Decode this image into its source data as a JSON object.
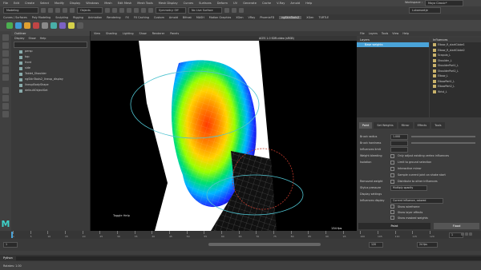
{
  "menubar": {
    "items": [
      "File",
      "Edit",
      "Create",
      "Select",
      "Modify",
      "Display",
      "Windows",
      "Mesh",
      "Edit Mesh",
      "Mesh Tools",
      "Mesh Display",
      "Curves",
      "Surfaces",
      "Deform",
      "UV",
      "Generate",
      "Cache",
      "V-Ray",
      "Arnold",
      "Help"
    ],
    "workspace_label": "Workspace :",
    "workspace_value": "Maya Classic*"
  },
  "status": {
    "mode": "Modeling",
    "objects": "Objects",
    "symmetry": "Symmetry: Off",
    "no_live": "No Live Surface",
    "user": "Lukamaetje"
  },
  "shelf": {
    "tabs": [
      "Curves / Surfaces",
      "Poly Modeling",
      "Sculpting",
      "Rigging",
      "Animation",
      "Rendering",
      "FX",
      "FX Caching",
      "Custom",
      "Arnold",
      "Bifrost",
      "MASH",
      "Motion Graphics",
      "XGen",
      "VRay",
      "PhoenixFD",
      "ngSkinTools2",
      "XGen",
      "TURTLE"
    ],
    "active_tab": "ngSkinTools2"
  },
  "outliner": {
    "title": "Outliner",
    "menu": [
      "Display",
      "Show",
      "Help"
    ],
    "items": [
      "persp",
      "top",
      "front",
      "side",
      "Tablet_Shoulder",
      "ngSkinTools2_lineup_display",
      "lineupBodyShape",
      "defaultObjectSet"
    ]
  },
  "viewport": {
    "menu": [
      "View",
      "Shading",
      "Lighting",
      "Show",
      "Renderer",
      "Panels"
    ],
    "mesh_label": "Symmetry: Object X",
    "camera": "persp",
    "fps": "134 fps",
    "toggle_help": "Toggle Help",
    "gpu_label": "ACES 1.0 SDR-video (sRGB)"
  },
  "layers_panel": {
    "menu": [
      "File",
      "Layers",
      "Tools",
      "View",
      "Help"
    ],
    "header": "Layers",
    "layer_name": "Base weights"
  },
  "influences": {
    "header": "Influences",
    "items": [
      "Elbow_R_startGlobe1",
      "Elbow_R_startGlobe2",
      "Scapula_L",
      "Shoulder_L",
      "ShoulderPart1_L",
      "ShoulderPart2_L",
      "Elbow_L",
      "ElbowPart1_L",
      "ElbowPart2_L",
      "Wrist_L"
    ]
  },
  "paint": {
    "tabs": [
      "Paint",
      "Set Weights",
      "Mirror",
      "Effects",
      "Tools"
    ],
    "active_tab": "Paint",
    "brush_radius_label": "Brush radius",
    "brush_radius_value": "1.000",
    "brush_hardness_label": "Brush hardness",
    "influences_limit_label": "Influences limit",
    "weight_bleeding_label": "Weight bleeding",
    "weight_bleeding_value": "Only adjust existing vertex influences",
    "isolation_label": "Isolation",
    "isolation_value": "Limit to ground selection",
    "interactive_mirror": "Interactive mirror",
    "sample_joint": "Sample current joint on shake start",
    "redistributed_weight_label": "Removed weight",
    "redistributed_weight_value": "Distribute to other influences",
    "stylus_pressure_label": "Stylus pressure",
    "stylus_pressure_value": "Multiply opacity",
    "display_settings": "Display settings",
    "influences_display_label": "Influences display",
    "influences_display_value": "Current influence, colored",
    "show_wireframe": "Show wireframe",
    "show_layer_effects": "Show layer effects",
    "show_masked_weights": "Show masked weights",
    "paint_button": "Paint",
    "flood_button": "Flood"
  },
  "timeline": {
    "ticks": [
      "1",
      "5",
      "10",
      "15",
      "20",
      "25",
      "30",
      "35",
      "40",
      "45",
      "50",
      "55",
      "60",
      "65",
      "70",
      "75",
      "80",
      "85",
      "90",
      "95",
      "100",
      "105",
      "110",
      "115",
      "120"
    ],
    "current_frame": "1",
    "range_start": "1",
    "range_end": "120",
    "fps": "24 fps",
    "no_char_set": "No Character Set",
    "no_anim_layer": "No Anim Layer"
  },
  "cmdline": {
    "lang": "Python",
    "help": "Rotates: 1.00"
  },
  "colors": {
    "accent": "#4aa3d8",
    "menubar": "#444444",
    "viewport_bg": "#000000"
  }
}
